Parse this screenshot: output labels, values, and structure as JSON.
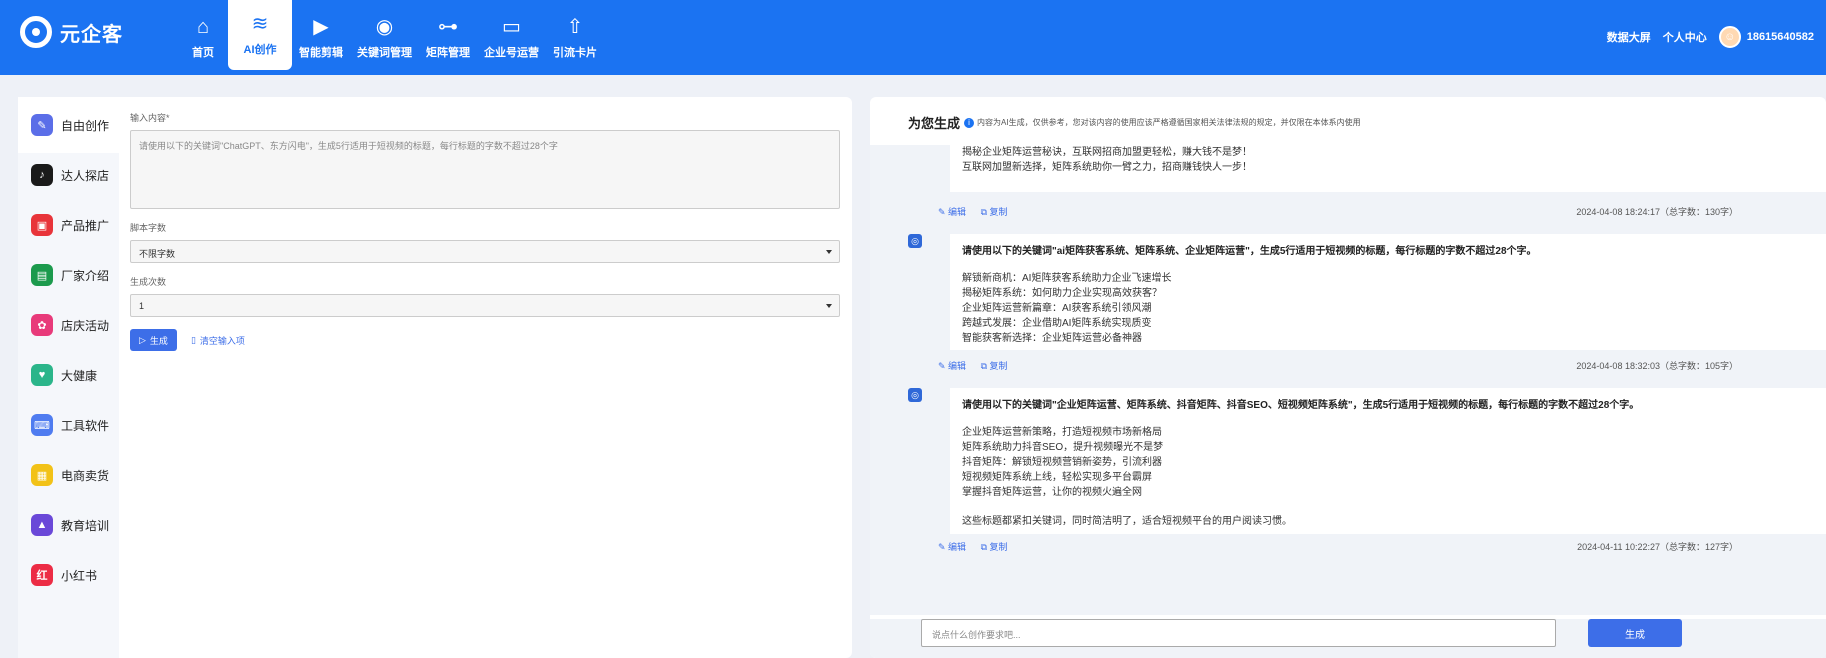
{
  "brand": {
    "name": "元企客"
  },
  "nav": [
    {
      "label": "首页",
      "icon": "home-icon",
      "glyph": "⌂"
    },
    {
      "label": "AI创作",
      "icon": "layers-icon",
      "glyph": "≋",
      "active": true
    },
    {
      "label": "智能剪辑",
      "icon": "video-icon",
      "glyph": "▶"
    },
    {
      "label": "关键词管理",
      "icon": "target-icon",
      "glyph": "◉"
    },
    {
      "label": "矩阵管理",
      "icon": "hierarchy-icon",
      "glyph": "⊶"
    },
    {
      "label": "企业号运营",
      "icon": "presentation-icon",
      "glyph": "▭"
    },
    {
      "label": "引流卡片",
      "icon": "upload-icon",
      "glyph": "⇧"
    }
  ],
  "topright": {
    "dashboard": "数据大屏",
    "personal": "个人中心",
    "phone": "18615640582"
  },
  "sidebar": [
    {
      "label": "自由创作",
      "glyph": "✎",
      "color": "#5b6ee8",
      "active": true
    },
    {
      "label": "达人探店",
      "glyph": "♪",
      "color": "#1a1a1a"
    },
    {
      "label": "产品推广",
      "glyph": "▣",
      "color": "#e8343a"
    },
    {
      "label": "厂家介绍",
      "glyph": "▤",
      "color": "#1c9a4d"
    },
    {
      "label": "店庆活动",
      "glyph": "✿",
      "color": "#e83a7a"
    },
    {
      "label": "大健康",
      "glyph": "♥",
      "color": "#2bb58a"
    },
    {
      "label": "工具软件",
      "glyph": "⌨",
      "color": "#4f7cf0"
    },
    {
      "label": "电商卖货",
      "glyph": "▦",
      "color": "#f2c218"
    },
    {
      "label": "教育培训",
      "glyph": "▲",
      "color": "#6a48d8"
    },
    {
      "label": "小红书",
      "glyph": "红",
      "color": "#ec2c45"
    }
  ],
  "form": {
    "input_label": "输入内容*",
    "input_placeholder": "请使用以下的关键词\"ChatGPT、东方闪电\"，生成5行适用于短视频的标题，每行标题的字数不超过28个字",
    "script_label": "脚本字数",
    "script_value": "不限字数",
    "count_label": "生成次数",
    "count_value": "1",
    "generate_label": "生成",
    "clear_label": "清空输入项"
  },
  "result": {
    "title": "为您生成",
    "note": "内容为AI生成，仅供参考，您对该内容的使用应该严格遵循国家相关法律法规的规定，并仅限在本体系内使用",
    "edit_label": "编辑",
    "copy_label": "复制",
    "items": [
      {
        "question": "",
        "lines": [
          "揭秘企业矩阵运营秘诀，互联网招商加盟更轻松，赚大钱不是梦！",
          "互联网加盟新选择，矩阵系统助你一臂之力，招商赚钱快人一步！"
        ],
        "timestamp": "2024-04-08 18:24:17（总字数：130字）"
      },
      {
        "question": "请使用以下的关键词\"ai矩阵获客系统、矩阵系统、企业矩阵运营\"，生成5行适用于短视频的标题，每行标题的字数不超过28个字。",
        "lines": [
          "解锁新商机：AI矩阵获客系统助力企业飞速增长",
          "揭秘矩阵系统：如何助力企业实现高效获客？",
          "企业矩阵运营新篇章：AI获客系统引领风潮",
          "跨越式发展：企业借助AI矩阵系统实现质变",
          "智能获客新选择：企业矩阵运营必备神器"
        ],
        "timestamp": "2024-04-08 18:32:03（总字数：105字）"
      },
      {
        "question": "请使用以下的关键词\"企业矩阵运营、矩阵系统、抖音矩阵、抖音SEO、短视频矩阵系统\"，生成5行适用于短视频的标题，每行标题的字数不超过28个字。",
        "lines": [
          "企业矩阵运营新策略，打造短视频市场新格局",
          "矩阵系统助力抖音SEO，提升视频曝光不是梦",
          "抖音矩阵：解锁短视频营销新姿势，引流利器",
          "短视频矩阵系统上线，轻松实现多平台霸屏",
          "掌握抖音矩阵运营，让你的视频火遍全网"
        ],
        "extra": "这些标题都紧扣关键词，同时简洁明了，适合短视频平台的用户阅读习惯。",
        "timestamp": "2024-04-11 10:22:27（总字数：127字）"
      }
    ]
  },
  "chat": {
    "placeholder": "说点什么创作要求吧...",
    "send_label": "生成"
  }
}
